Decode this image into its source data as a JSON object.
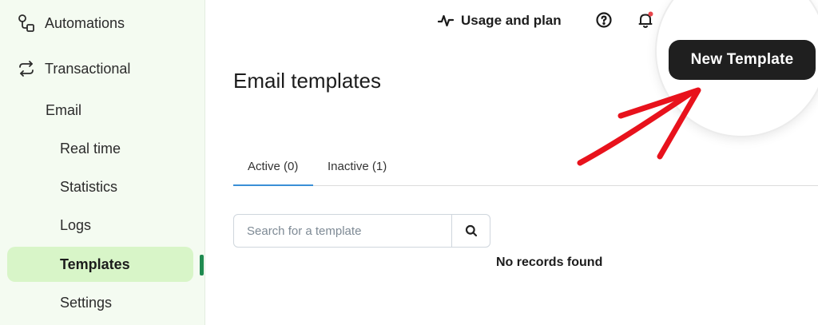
{
  "sidebar": {
    "automations": "Automations",
    "transactional": "Transactional",
    "email": "Email",
    "items": [
      {
        "label": "Real time"
      },
      {
        "label": "Statistics"
      },
      {
        "label": "Logs"
      },
      {
        "label": "Templates",
        "active": true
      },
      {
        "label": "Settings"
      }
    ]
  },
  "header": {
    "usage_label": "Usage and plan",
    "new_template_label": "New Template"
  },
  "main": {
    "title": "Email templates",
    "tabs": [
      {
        "label": "Active (0)",
        "active": true
      },
      {
        "label": "Inactive (1)",
        "active": false
      }
    ],
    "search": {
      "placeholder": "Search for a template",
      "value": ""
    },
    "empty_message": "No records found"
  },
  "colors": {
    "sidebar_bg": "#f4fbf1",
    "active_item_bg": "#d8f5c8",
    "accent_green": "#1f8a50",
    "tab_underline": "#3a8fd6",
    "button_bg": "#1f1f1f",
    "annotation_arrow": "#e8121c",
    "notification_dot": "#e8464c"
  },
  "icons": {
    "automations": "automations-icon",
    "transactional": "transactional-icon",
    "usage": "activity-icon",
    "help": "help-circle-icon",
    "notifications": "bell-icon",
    "search": "search-icon"
  }
}
